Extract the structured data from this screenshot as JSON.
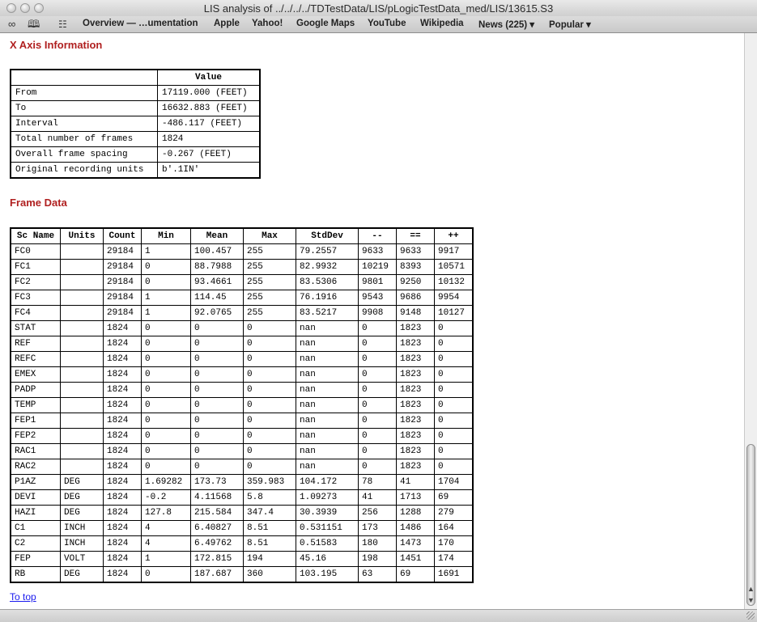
{
  "window": {
    "title": "LIS analysis of ../../../../TDTestData/LIS/pLogicTestData_med/LIS/13615.S3"
  },
  "bookmarks": {
    "items": [
      {
        "label": "Overview — …umentation"
      },
      {
        "label": "Apple"
      },
      {
        "label": "Yahoo!"
      },
      {
        "label": "Google Maps"
      },
      {
        "label": "YouTube"
      },
      {
        "label": "Wikipedia"
      },
      {
        "label": "News (225) ▾"
      },
      {
        "label": "Popular ▾"
      }
    ]
  },
  "x_axis": {
    "heading": "X Axis Information",
    "value_header": "Value",
    "rows": [
      {
        "label": "From",
        "value": "17119.000 (FEET)"
      },
      {
        "label": "To",
        "value": "16632.883 (FEET)"
      },
      {
        "label": "Interval",
        "value": "-486.117 (FEET)"
      },
      {
        "label": "Total number of frames",
        "value": "1824"
      },
      {
        "label": "Overall frame spacing",
        "value": "-0.267 (FEET)"
      },
      {
        "label": "Original recording units",
        "value": "b'.1IN'"
      }
    ]
  },
  "frame_data": {
    "heading": "Frame Data",
    "columns": [
      "Sc Name",
      "Units",
      "Count",
      "Min",
      "Mean",
      "Max",
      "StdDev",
      "--",
      "==",
      "++"
    ],
    "rows": [
      [
        "FC0",
        "",
        "29184",
        "1",
        "100.457",
        "255",
        "79.2557",
        "9633",
        "9633",
        "9917"
      ],
      [
        "FC1",
        "",
        "29184",
        "0",
        "88.7988",
        "255",
        "82.9932",
        "10219",
        "8393",
        "10571"
      ],
      [
        "FC2",
        "",
        "29184",
        "0",
        "93.4661",
        "255",
        "83.5306",
        "9801",
        "9250",
        "10132"
      ],
      [
        "FC3",
        "",
        "29184",
        "1",
        "114.45",
        "255",
        "76.1916",
        "9543",
        "9686",
        "9954"
      ],
      [
        "FC4",
        "",
        "29184",
        "1",
        "92.0765",
        "255",
        "83.5217",
        "9908",
        "9148",
        "10127"
      ],
      [
        "STAT",
        "",
        "1824",
        "0",
        "0",
        "0",
        "nan",
        "0",
        "1823",
        "0"
      ],
      [
        "REF",
        "",
        "1824",
        "0",
        "0",
        "0",
        "nan",
        "0",
        "1823",
        "0"
      ],
      [
        "REFC",
        "",
        "1824",
        "0",
        "0",
        "0",
        "nan",
        "0",
        "1823",
        "0"
      ],
      [
        "EMEX",
        "",
        "1824",
        "0",
        "0",
        "0",
        "nan",
        "0",
        "1823",
        "0"
      ],
      [
        "PADP",
        "",
        "1824",
        "0",
        "0",
        "0",
        "nan",
        "0",
        "1823",
        "0"
      ],
      [
        "TEMP",
        "",
        "1824",
        "0",
        "0",
        "0",
        "nan",
        "0",
        "1823",
        "0"
      ],
      [
        "FEP1",
        "",
        "1824",
        "0",
        "0",
        "0",
        "nan",
        "0",
        "1823",
        "0"
      ],
      [
        "FEP2",
        "",
        "1824",
        "0",
        "0",
        "0",
        "nan",
        "0",
        "1823",
        "0"
      ],
      [
        "RAC1",
        "",
        "1824",
        "0",
        "0",
        "0",
        "nan",
        "0",
        "1823",
        "0"
      ],
      [
        "RAC2",
        "",
        "1824",
        "0",
        "0",
        "0",
        "nan",
        "0",
        "1823",
        "0"
      ],
      [
        "P1AZ",
        "DEG",
        "1824",
        "1.69282",
        "173.73",
        "359.983",
        "104.172",
        "78",
        "41",
        "1704"
      ],
      [
        "DEVI",
        "DEG",
        "1824",
        "-0.2",
        "4.11568",
        "5.8",
        "1.09273",
        "41",
        "1713",
        "69"
      ],
      [
        "HAZI",
        "DEG",
        "1824",
        "127.8",
        "215.584",
        "347.4",
        "30.3939",
        "256",
        "1288",
        "279"
      ],
      [
        "C1",
        "INCH",
        "1824",
        "4",
        "6.40827",
        "8.51",
        "0.531151",
        "173",
        "1486",
        "164"
      ],
      [
        "C2",
        "INCH",
        "1824",
        "4",
        "6.49762",
        "8.51",
        "0.51583",
        "180",
        "1473",
        "170"
      ],
      [
        "FEP",
        "VOLT",
        "1824",
        "1",
        "172.815",
        "194",
        "45.16",
        "198",
        "1451",
        "174"
      ],
      [
        "RB",
        "DEG",
        "1824",
        "0",
        "187.687",
        "360",
        "103.195",
        "63",
        "69",
        "1691"
      ]
    ]
  },
  "footer": {
    "to_top": "To top"
  }
}
